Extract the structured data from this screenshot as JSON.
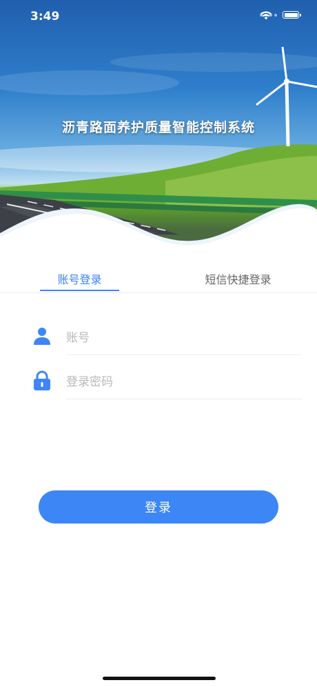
{
  "status_bar": {
    "time": "3:49"
  },
  "header": {
    "title": "沥青路面养护质量智能控制系统"
  },
  "tabs": [
    {
      "label": "账号登录",
      "active": true
    },
    {
      "label": "短信快捷登录",
      "active": false
    }
  ],
  "form": {
    "account_placeholder": "账号",
    "password_placeholder": "登录密码",
    "account_value": "",
    "password_value": ""
  },
  "login_button": {
    "label": "登录"
  },
  "colors": {
    "accent": "#3d86f5",
    "tab_active": "#3b82f6",
    "placeholder": "#b8b8b8"
  },
  "icons": [
    "wifi-icon",
    "battery-icon",
    "user-icon",
    "lock-icon"
  ]
}
